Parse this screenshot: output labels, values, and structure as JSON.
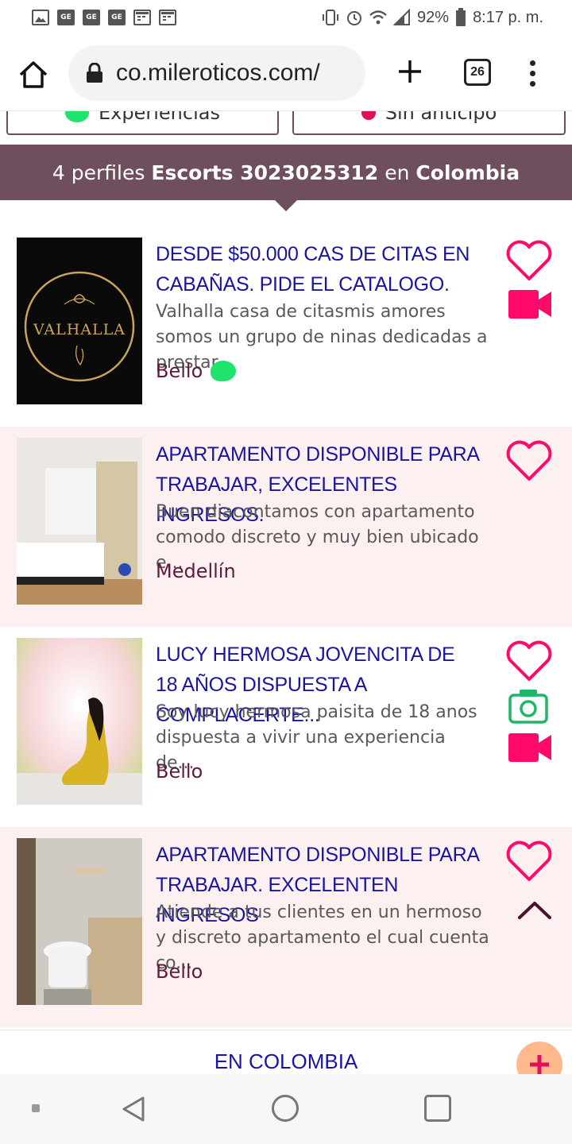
{
  "status_bar": {
    "notification_icons": [
      "image-icon",
      "ge-icon",
      "ge-icon",
      "ge-icon",
      "calendar-icon",
      "calendar-icon"
    ],
    "battery": "92%",
    "time": "8:17 p. m."
  },
  "browser": {
    "url": "co.mileroticos.com/",
    "tab_count": "26"
  },
  "filters": [
    {
      "label": "Experiencias",
      "icon": "chat-bubble-icon",
      "color": "#1ee36c"
    },
    {
      "label": "Sin anticipo",
      "icon": "no-money-icon",
      "color": "#e0105c"
    }
  ],
  "banner": {
    "prefix": "4 perfiles",
    "keyword": "Escorts 3023025312",
    "connector": "en",
    "place": "Colombia"
  },
  "listings": [
    {
      "title": "DESDE $50.000 CAS DE CITAS EN CABAÑAS. PIDE EL CATALOGO.",
      "description": "Valhalla casa de citasmis amores somos un grupo de ninas dedicadas a prestar...",
      "location": "Bello",
      "thumb_text": "VALHALLA",
      "badges": [
        "heart-icon",
        "video-icon",
        "chat-icon"
      ]
    },
    {
      "title": "APARTAMENTO DISPONIBLE PARA TRABAJAR, EXCELENTES INGRESOS.",
      "description": "Buen diacontamos con apartamento comodo discreto y muy bien ubicado e...",
      "location": "Medellín",
      "badges": [
        "heart-icon"
      ]
    },
    {
      "title": "LUCY HERMOSA JOVENCITA DE 18 AÑOS DISPUESTA A COMPLACERTE...",
      "description": "Soy lucy hermosa paisita de 18 anos dispuesta a vivir una experiencia de...",
      "location": "Bello",
      "badges": [
        "heart-icon",
        "camera-icon",
        "video-icon"
      ]
    },
    {
      "title": "APARTAMENTO DISPONIBLE PARA TRABAJAR. EXCELENTEN INGRESOS",
      "description": "Atiende a tus clientes en un hermoso y discreto apartamento el cual cuenta co...",
      "location": "Bello",
      "badges": [
        "heart-icon",
        "chevron-up-icon"
      ]
    }
  ],
  "footer": {
    "title": "EN COLOMBIA"
  },
  "colors": {
    "banner_bg": "#6f4f5d",
    "title_blue": "#1a14a3",
    "accent_pink": "#ff0a6a",
    "location_color": "#5e1b3c",
    "alt_row_bg": "#fcf1f0"
  }
}
